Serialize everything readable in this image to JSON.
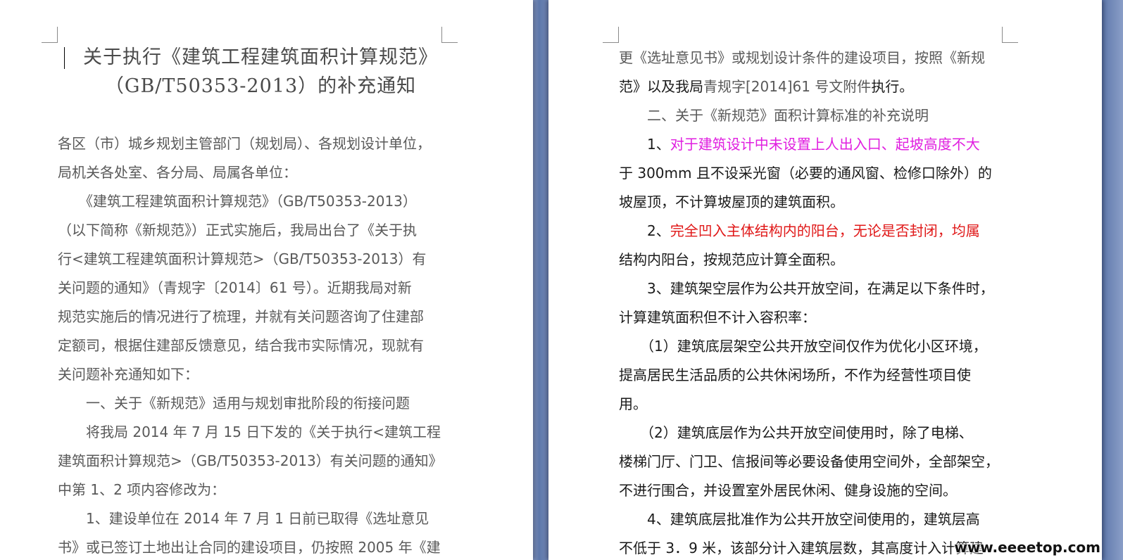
{
  "left_page": {
    "title_line1": "关于执行《建筑工程建筑面积计算规范》",
    "title_line2": "（GB/T50353-2013）的补充通知",
    "lines": [
      "各区（市）城乡规划主管部门（规划局）、各规划设计单位，",
      "局机关各处室、各分局、局属各单位：",
      "　　《建筑工程建筑面积计算规范》（GB/T50353-2013）",
      "（以下简称《新规范》）正式实施后，我局出台了《关于执",
      "行<建筑工程建筑面积计算规范>（GB/T50353-2013）有",
      "关问题的通知》（青规字〔2014〕61 号）。近期我局对新",
      "规范实施后的情况进行了梳理，并就有关问题咨询了住建部",
      "定额司，根据住建部反馈意见，结合我市实际情况，现就有",
      "关问题补充通知如下：",
      "　　一、关于《新规范》适用与规划审批阶段的衔接问题",
      "　　将我局 2014 年 7 月 15 日下发的《关于执行<建筑工程",
      "建筑面积计算规范>（GB/T50353-2013）有关问题的通知》",
      "中第 1、2 项内容修改为：",
      "　　1、建设单位在 2014 年 7 月 1 日前已取得《选址意见",
      "书》或已签订土地出让合同的建设项目，仍按照 2005 年《建"
    ]
  },
  "right_page": {
    "line1": "更《选址意见书》或规划设计条件的建设项目，按照《新规",
    "line2_a": "范》以及我局",
    "line2_b": "青规字[2014]61 号文附件",
    "line2_c": "执行。",
    "line3": "　　二、关于《新规范》面积计算标准的补充说明",
    "item1_num": "　　1、",
    "item1_line1": "对于建筑设计中未设置上人出入口、起坡高度不大",
    "item1_line2": "于 300mm 且不设采光窗（必要的通风窗、检修口除外）的",
    "item1_line3": "坡屋顶，不计算坡屋顶的建筑面积。",
    "item2_num": "　　2、",
    "item2_line1": "完全凹入主体结构内的阳台，无论是否封闭，均属",
    "item2_line2": "结构内阳台，按规范应计算全面积。",
    "lines_rest": [
      "　　3、建筑架空层作为公共开放空间，在满足以下条件时，",
      "计算建筑面积但不计入容积率：",
      "　　（1）建筑底层架空公共开放空间仅作为优化小区环境，",
      "提高居民生活品质的公共休闲场所，不作为经营性项目使",
      "用。",
      "　　（2）建筑底层作为公共开放空间使用时，除了电梯、",
      "楼梯门厅、门卫、信报间等必要设备使用空间外，全部架空，",
      "不进行围合，并设置室外居民休闲、健身设施的空间。",
      "　　4、建筑底层批准作为公共开放空间使用的，建筑层高",
      "不低于 3．9 米，该部分计入建筑层数，其高度计入计算建"
    ]
  },
  "watermark": "www.eeeetop.com",
  "colors": {
    "magenta": "#e01ee0",
    "red": "#e01818",
    "gray_text": "#595959",
    "dark_text": "#1a1a1a"
  }
}
